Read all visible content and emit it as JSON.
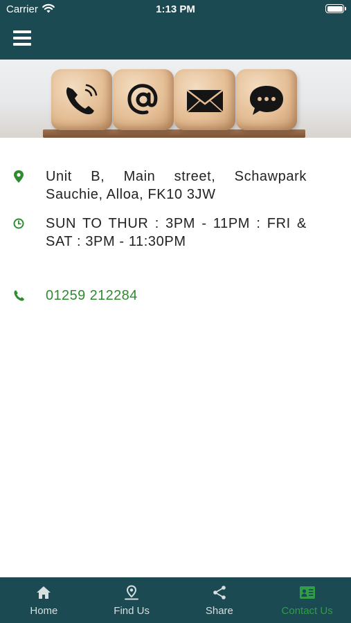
{
  "status_bar": {
    "carrier": "Carrier",
    "time": "1:13 PM"
  },
  "header": {
    "menu_icon": "hamburger-icon"
  },
  "banner": {
    "icons": [
      "phone-icon",
      "at-sign-icon",
      "envelope-icon",
      "chat-bubble-icon"
    ]
  },
  "contact": {
    "address": "Unit B, Main street, Schawpark Sauchie, Alloa, FK10 3JW",
    "hours": "SUN TO THUR : 3PM - 11PM : FRI & SAT : 3PM - 11:30PM",
    "phone": "01259 212284"
  },
  "tabs": [
    {
      "label": "Home",
      "icon": "home-icon",
      "active": false
    },
    {
      "label": "Find Us",
      "icon": "map-pin-icon",
      "active": false
    },
    {
      "label": "Share",
      "icon": "share-icon",
      "active": false
    },
    {
      "label": "Contact Us",
      "icon": "contact-card-icon",
      "active": true
    }
  ],
  "colors": {
    "header": "#1c4a52",
    "accent": "#2e8b2e",
    "active_tab": "#2f9e46"
  }
}
